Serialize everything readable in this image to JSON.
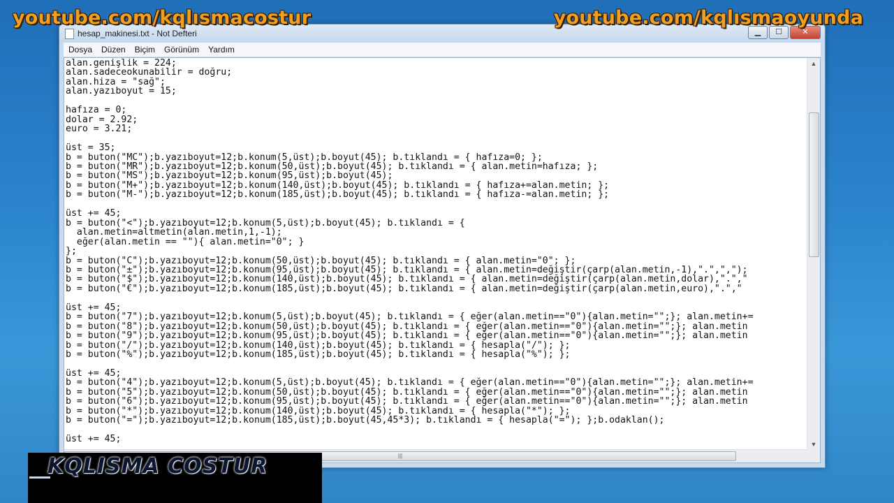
{
  "watermarks": {
    "left": "youtube.com/kqlısmacostur",
    "right": "youtube.com/kqlısmaoyunda"
  },
  "window": {
    "title": "hesap_makinesi.txt - Not Defteri",
    "controls": {
      "minimize": "▁",
      "maximize": "☐",
      "close": "✕"
    }
  },
  "menu": {
    "items": [
      "Dosya",
      "Düzen",
      "Biçim",
      "Görünüm",
      "Yardım"
    ]
  },
  "editor": {
    "content": "alan.genişlik = 224;\nalan.sadeceokunabilir = doğru;\nalan.hiza = \"sağ\";\nalan.yazıboyut = 15;\n\nhafıza = 0;\ndolar = 2.92;\neuro = 3.21;\n\nüst = 35;\nb = buton(\"MC\");b.yazıboyut=12;b.konum(5,üst);b.boyut(45); b.tıklandı = { hafıza=0; };\nb = buton(\"MR\");b.yazıboyut=12;b.konum(50,üst);b.boyut(45); b.tıklandı = { alan.metin=hafıza; };\nb = buton(\"MS\");b.yazıboyut=12;b.konum(95,üst);b.boyut(45);\nb = buton(\"M+\");b.yazıboyut=12;b.konum(140,üst);b.boyut(45); b.tıklandı = { hafıza+=alan.metin; };\nb = buton(\"M-\");b.yazıboyut=12;b.konum(185,üst);b.boyut(45); b.tıklandı = { hafıza-=alan.metin; };\n\nüst += 45;\nb = buton(\"<\");b.yazıboyut=12;b.konum(5,üst);b.boyut(45); b.tıklandı = {\n  alan.metin=altmetin(alan.metin,1,-1);\n  eğer(alan.metin == \"\"){ alan.metin=\"0\"; }\n};\nb = buton(\"C\");b.yazıboyut=12;b.konum(50,üst);b.boyut(45); b.tıklandı = { alan.metin=\"0\"; };\nb = buton(\"±\");b.yazıboyut=12;b.konum(95,üst);b.boyut(45); b.tıklandı = { alan.metin=değiştir(çarp(alan.metin,-1),\".\",\",\");\nb = buton(\"$\");b.yazıboyut=12;b.konum(140,üst);b.boyut(45); b.tıklandı = { alan.metin=değiştir(çarp(alan.metin,dolar),\".\",\"\nb = buton(\"€\");b.yazıboyut=12;b.konum(185,üst);b.boyut(45); b.tıklandı = { alan.metin=değiştir(çarp(alan.metin,euro),\".\",\"\n\nüst += 45;\nb = buton(\"7\");b.yazıboyut=12;b.konum(5,üst);b.boyut(45); b.tıklandı = { eğer(alan.metin==\"0\"){alan.metin=\"\";}; alan.metin+=\nb = buton(\"8\");b.yazıboyut=12;b.konum(50,üst);b.boyut(45); b.tıklandı = { eğer(alan.metin==\"0\"){alan.metin=\"\";}; alan.metin\nb = buton(\"9\");b.yazıboyut=12;b.konum(95,üst);b.boyut(45); b.tıklandı = { eğer(alan.metin==\"0\"){alan.metin=\"\";}; alan.metin\nb = buton(\"/\");b.yazıboyut=12;b.konum(140,üst);b.boyut(45); b.tıklandı = { hesapla(\"/\"); };\nb = buton(\"%\");b.yazıboyut=12;b.konum(185,üst);b.boyut(45); b.tıklandı = { hesapla(\"%\"); };\n\nüst += 45;\nb = buton(\"4\");b.yazıboyut=12;b.konum(5,üst);b.boyut(45); b.tıklandı = { eğer(alan.metin==\"0\"){alan.metin=\"\";}; alan.metin+=\nb = buton(\"5\");b.yazıboyut=12;b.konum(50,üst);b.boyut(45); b.tıklandı = { eğer(alan.metin==\"0\"){alan.metin=\"\";}; alan.metin\nb = buton(\"6\");b.yazıboyut=12;b.konum(95,üst);b.boyut(45); b.tıklandı = { eğer(alan.metin==\"0\"){alan.metin=\"\";}; alan.metin\nb = buton(\"*\");b.yazıboyut=12;b.konum(140,üst);b.boyut(45); b.tıklandı = { hesapla(\"*\"); };\nb = buton(\"=\");b.yazıboyut=12;b.konum(185,üst);b.boyut(45,45*3); b.tıklandı = { hesapla(\"=\"); };b.odaklan();\n\nüst += 45;"
  },
  "logo": {
    "text": "KQLISMA COSTUR"
  }
}
